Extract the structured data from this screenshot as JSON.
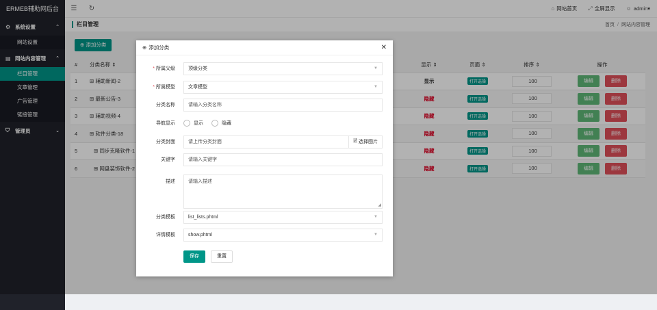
{
  "brand": "ERMEB辅助网后台",
  "sidebar": {
    "groups": [
      {
        "label": "系统设置",
        "children": [
          "网站设置"
        ]
      },
      {
        "label": "网站内容管理",
        "children": [
          "栏目管理",
          "文章管理",
          "广告管理",
          "链接管理"
        ]
      },
      {
        "label": "管理员",
        "children": []
      }
    ]
  },
  "topbar": {
    "site_home": "网站首页",
    "fullscreen": "全屏显示",
    "user": "admin"
  },
  "crumb": {
    "title": "栏目管理",
    "home": "首页",
    "sep": "/",
    "current": "网站内容管理"
  },
  "content": {
    "add_button": "添加分类",
    "columns": {
      "id": "#",
      "name": "分类名称",
      "show": "显示",
      "page": "页面",
      "sort": "排序",
      "ops": "操作"
    },
    "rows": [
      {
        "id": "1",
        "name": "辅助新闻-2",
        "show": "显示",
        "show_on": true,
        "page": "打开选操",
        "sort": "100",
        "edit": "编辑",
        "del": "删除"
      },
      {
        "id": "2",
        "name": "最新公告-3",
        "show": "隐藏",
        "show_on": false,
        "page": "打开选操",
        "sort": "100",
        "edit": "编辑",
        "del": "删除"
      },
      {
        "id": "3",
        "name": "辅助视频-4",
        "show": "隐藏",
        "show_on": false,
        "page": "打开选操",
        "sort": "100",
        "edit": "编辑",
        "del": "删除"
      },
      {
        "id": "4",
        "name": "软件分类-18",
        "show": "隐藏",
        "show_on": false,
        "page": "打开选操",
        "sort": "100",
        "edit": "编辑",
        "del": "删除"
      },
      {
        "id": "5",
        "name": "同步克隆软件-1",
        "show": "隐藏",
        "show_on": false,
        "page": "打开选操",
        "sort": "100",
        "edit": "编辑",
        "del": "删除"
      },
      {
        "id": "6",
        "name": "网盘装饰软件-2",
        "show": "隐藏",
        "show_on": false,
        "page": "打开选操",
        "sort": "100",
        "edit": "编辑",
        "del": "删除"
      }
    ]
  },
  "modal": {
    "title": "添加分类",
    "parent_label": "所属父级",
    "parent_value": "顶级分类",
    "model_label": "所属模型",
    "model_value": "文章模型",
    "name_label": "分类名称",
    "name_placeholder": "请输入分类名称",
    "nav_label": "导航显示",
    "nav_show": "显示",
    "nav_hide": "隐藏",
    "cover_label": "分类封面",
    "cover_placeholder": "请上传分类封面",
    "cover_button": "选择图片",
    "keyword_label": "关键字",
    "keyword_placeholder": "请输入关键字",
    "desc_label": "描述",
    "desc_placeholder": "请输入描述",
    "list_tpl_label": "分类模板",
    "list_tpl_value": "list_lists.phtml",
    "detail_tpl_label": "详情模板",
    "detail_tpl_value": "show.phtml",
    "save": "保存",
    "reset": "重置"
  }
}
